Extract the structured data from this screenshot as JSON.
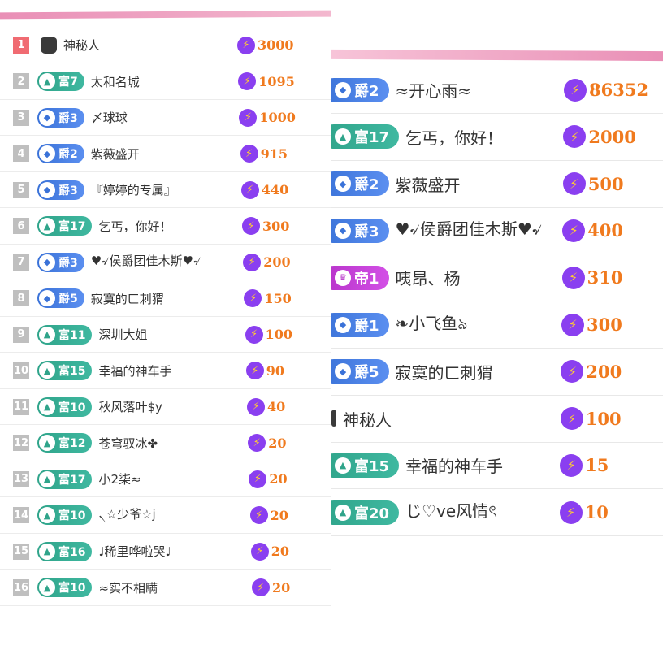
{
  "left_list": [
    {
      "rank": "1",
      "badge": null,
      "name": "神秘人",
      "amount": "3000"
    },
    {
      "rank": "2",
      "badge": "富7",
      "badge_type": "fu",
      "name": "太和名城",
      "amount": "1095"
    },
    {
      "rank": "3",
      "badge": "爵3",
      "badge_type": "jue",
      "name": "〆球球",
      "amount": "1000"
    },
    {
      "rank": "4",
      "badge": "爵2",
      "badge_type": "jue",
      "name": "紫薇盛开",
      "amount": "915"
    },
    {
      "rank": "5",
      "badge": "爵3",
      "badge_type": "jue",
      "name": "『婷婷的专属』",
      "amount": "440"
    },
    {
      "rank": "6",
      "badge": "富17",
      "badge_type": "fu",
      "name": "乞丐，你好！",
      "amount": "300"
    },
    {
      "rank": "7",
      "badge": "爵3",
      "badge_type": "jue",
      "name": "♥৵侯爵团佳木斯♥৵",
      "amount": "200"
    },
    {
      "rank": "8",
      "badge": "爵5",
      "badge_type": "jue",
      "name": "寂寞的ㄈ刺猬",
      "amount": "150"
    },
    {
      "rank": "9",
      "badge": "富11",
      "badge_type": "fu",
      "name": "深圳大姐",
      "amount": "100"
    },
    {
      "rank": "10",
      "badge": "富15",
      "badge_type": "fu",
      "name": "幸福的神车手",
      "amount": "90"
    },
    {
      "rank": "11",
      "badge": "富10",
      "badge_type": "fu",
      "name": "秋风落叶$y",
      "amount": "40"
    },
    {
      "rank": "12",
      "badge": "富12",
      "badge_type": "fu",
      "name": "苍穹驭冰✤",
      "amount": "20"
    },
    {
      "rank": "13",
      "badge": "富17",
      "badge_type": "fu",
      "name": "小2柒≈",
      "amount": "20"
    },
    {
      "rank": "14",
      "badge": "富10",
      "badge_type": "fu",
      "name": "৲☆少爷☆j",
      "amount": "20"
    },
    {
      "rank": "15",
      "badge": "富16",
      "badge_type": "fu",
      "name": "♩稀里哗啦哭♩",
      "amount": "20"
    },
    {
      "rank": "16",
      "badge": "富10",
      "badge_type": "fu",
      "name": "≈实不相瞒",
      "amount": "20"
    }
  ],
  "right_list": [
    {
      "badge": "爵2",
      "badge_type": "jue",
      "name": "≈开心雨≈",
      "amount": "86352"
    },
    {
      "badge": "富17",
      "badge_type": "fu",
      "name": "乞丐，你好！",
      "amount": "2000"
    },
    {
      "badge": "爵2",
      "badge_type": "jue",
      "name": "紫薇盛开",
      "amount": "500"
    },
    {
      "badge": "爵3",
      "badge_type": "jue",
      "name": "♥৵侯爵团佳木斯♥৵",
      "amount": "400"
    },
    {
      "badge": "帝1",
      "badge_type": "di",
      "name": "咦昂、杨",
      "amount": "310"
    },
    {
      "badge": "爵1",
      "badge_type": "jue",
      "name": "❧小飞鱼ঌ",
      "amount": "300"
    },
    {
      "badge": "爵5",
      "badge_type": "jue",
      "name": "寂寞的ㄈ刺猬",
      "amount": "200"
    },
    {
      "badge": null,
      "name": "神秘人",
      "amount": "100"
    },
    {
      "badge": "富15",
      "badge_type": "fu",
      "name": "幸福的神车手",
      "amount": "15"
    },
    {
      "badge": "富20",
      "badge_type": "fu",
      "name": "じ♡ve风情ৎ",
      "amount": "10"
    }
  ],
  "icons": {
    "gift": "lightning-coin-icon",
    "mystery": "mystery-person-icon",
    "fu": "fortune-icon",
    "jue": "noble-icon",
    "di": "emperor-icon"
  },
  "colors": {
    "amount": "#f07a1e",
    "fu": "#2fa48a",
    "jue": "#3a72d8",
    "di": "#b633c9",
    "rank1": "#f06b72",
    "accent_bar": "#e98fb6"
  }
}
